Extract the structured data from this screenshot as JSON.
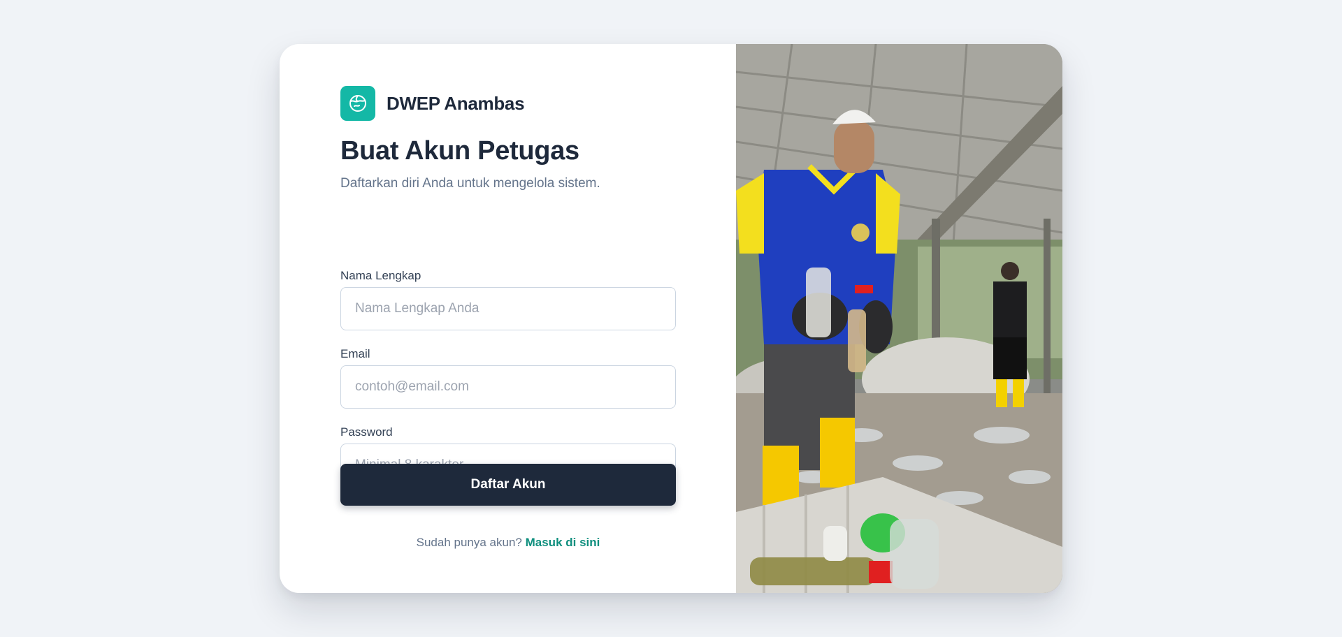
{
  "brand": {
    "name": "DWEP Anambas",
    "logo_icon": "globe-icon",
    "accent_color": "#14b8a6"
  },
  "heading": {
    "title": "Buat Akun Petugas",
    "subtitle": "Daftarkan diri Anda untuk mengelola sistem."
  },
  "form": {
    "name": {
      "label": "Nama Lengkap",
      "placeholder": "Nama Lengkap Anda",
      "value": ""
    },
    "email": {
      "label": "Email",
      "placeholder": "contoh@email.com",
      "value": ""
    },
    "password": {
      "label": "Password",
      "placeholder": "Minimal 8 karakter",
      "value": ""
    },
    "submit_label": "Daftar Akun",
    "button_color": "#1e293b"
  },
  "footer": {
    "prompt": "Sudah punya akun?",
    "link_label": "Masuk di sini",
    "link_color": "#0f8f7e"
  },
  "photo": {
    "alt": "Petugas memilah sampah botol plastik"
  }
}
